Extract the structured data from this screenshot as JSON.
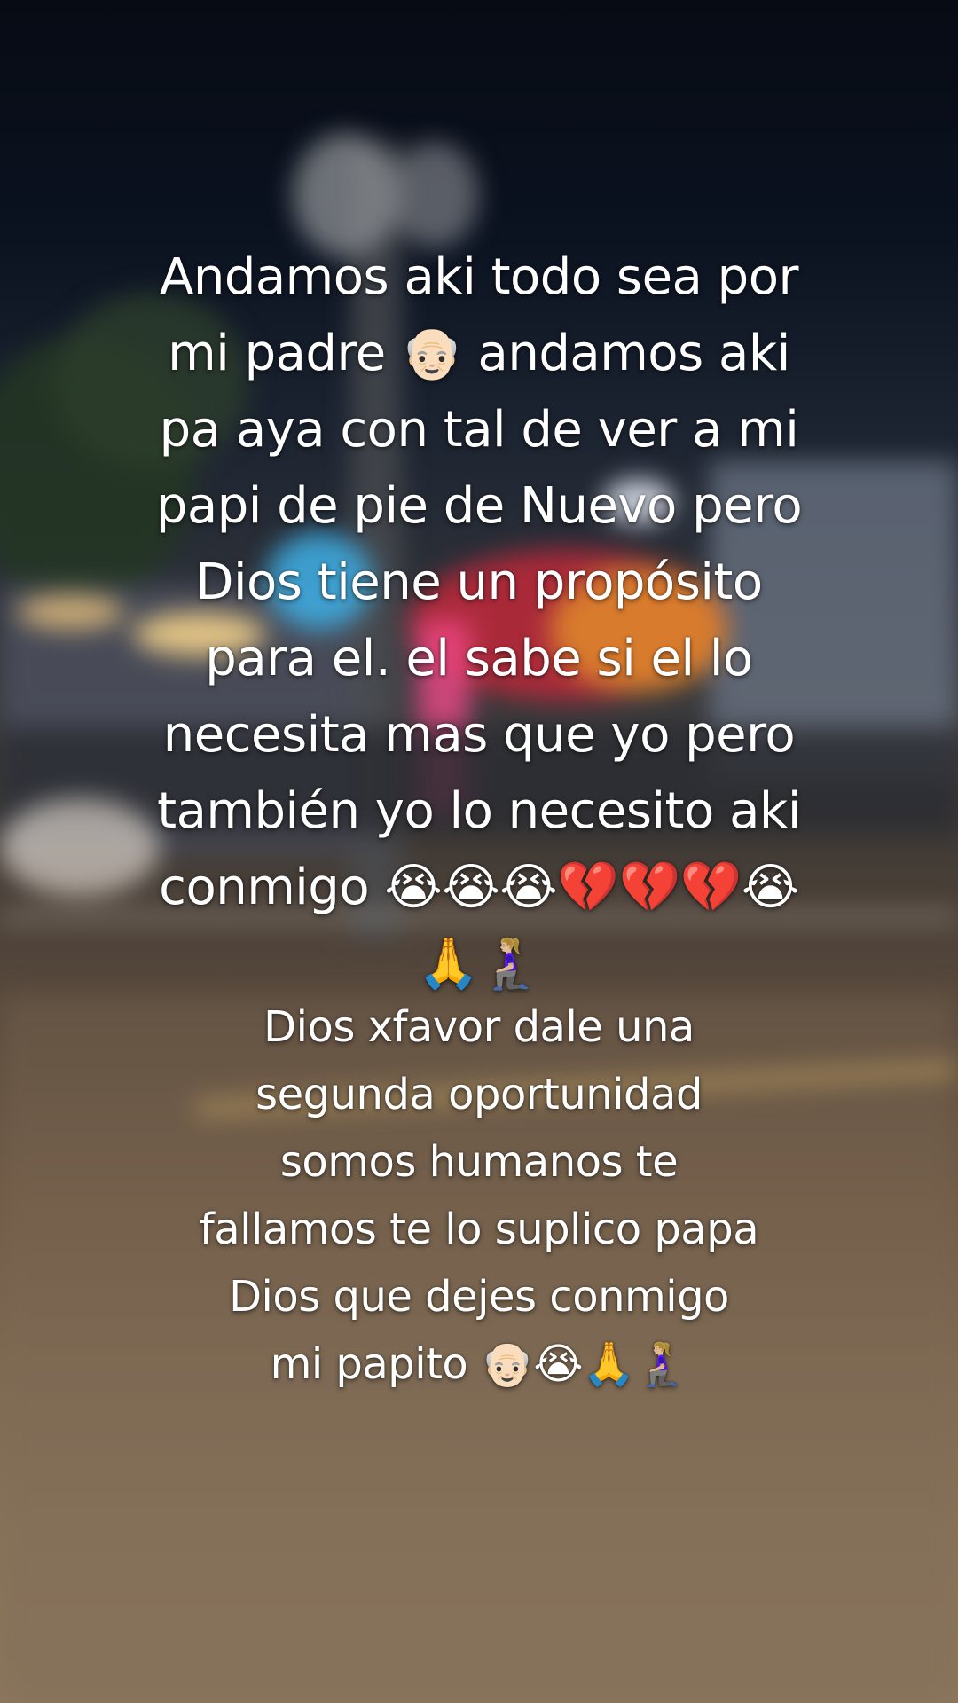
{
  "caption_main": "Andamos aki todo sea por\nmi padre 👴🏻 andamos aki\npa   aya con tal de ver a mi\npapi de pie de Nuevo pero\nDios tiene un propósito\npara el. el sabe si el lo\nnecesita mas que yo pero\ntambién yo lo necesito aki\nconmigo 😭😭😭💔💔💔😭\n🙏🧎🏼‍♀️",
  "caption_second": "Dios xfavor dale una\nsegunda oportunidad\nsomos humanos te\nfallamos te lo suplico papa\nDios que dejes conmigo\nmi papito 👴🏻😭🙏🧎🏼‍♀️"
}
